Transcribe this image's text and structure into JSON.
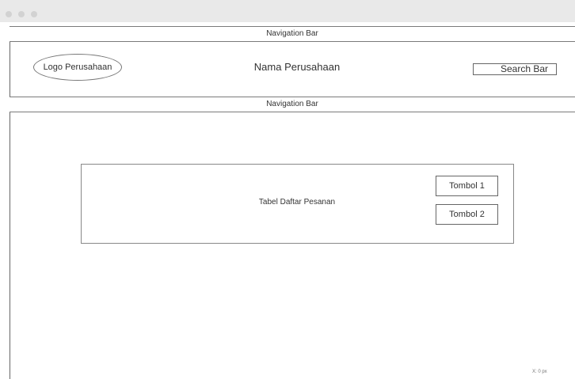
{
  "header": {
    "top_nav_label": "Navigation Bar",
    "logo_label": "Logo Perusahaan",
    "company_name": "Nama Perusahaan",
    "search_label": "Search Bar",
    "bottom_nav_label": "Navigation Bar"
  },
  "main": {
    "table_label": "Tabel Daftar Pesanan",
    "buttons": [
      {
        "label": "Tombol 1"
      },
      {
        "label": "Tombol 2"
      }
    ]
  },
  "footer": {
    "coordinate_readout": "X: 0 px"
  }
}
